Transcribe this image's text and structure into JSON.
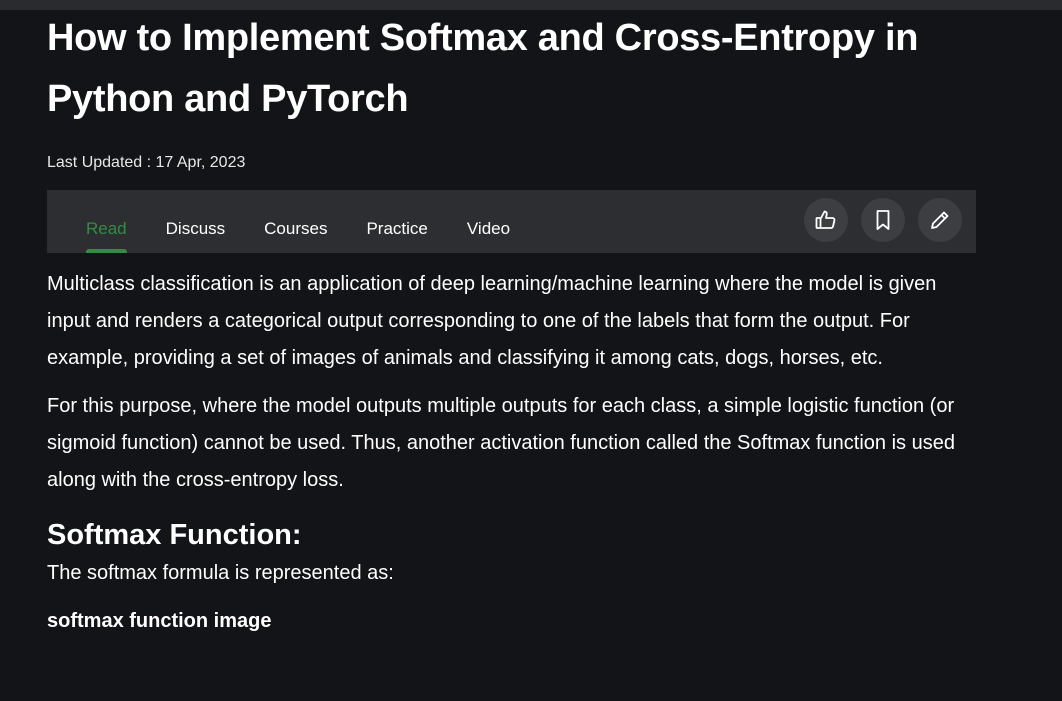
{
  "article": {
    "title": "How to Implement Softmax and Cross-Entropy in Python and PyTorch",
    "last_updated": "Last Updated : 17 Apr, 2023"
  },
  "tabs": [
    {
      "label": "Read",
      "active": true
    },
    {
      "label": "Discuss",
      "active": false
    },
    {
      "label": "Courses",
      "active": false
    },
    {
      "label": "Practice",
      "active": false
    },
    {
      "label": "Video",
      "active": false
    }
  ],
  "actions": [
    {
      "icon": "thumbs-up-icon"
    },
    {
      "icon": "bookmark-icon"
    },
    {
      "icon": "pencil-icon"
    }
  ],
  "content": {
    "para1": "Multiclass classification is an application of deep learning/machine learning where the model is given input and renders a categorical output corresponding to one of the labels that form the output. For example, providing a set of images of animals and classifying it among cats, dogs, horses, etc.",
    "para2": "For this purpose, where the model outputs multiple outputs for each class, a simple logistic function (or sigmoid function) cannot be used. Thus, another activation function called the Softmax function is used along with the cross-entropy loss.",
    "heading": "Softmax Function:",
    "para3": "The softmax formula is represented as:",
    "image_alt": "softmax function image"
  },
  "colors": {
    "background": "#131417",
    "tabbar": "#2d2e31",
    "accent": "#2f8d46",
    "button": "#3d3e42"
  }
}
